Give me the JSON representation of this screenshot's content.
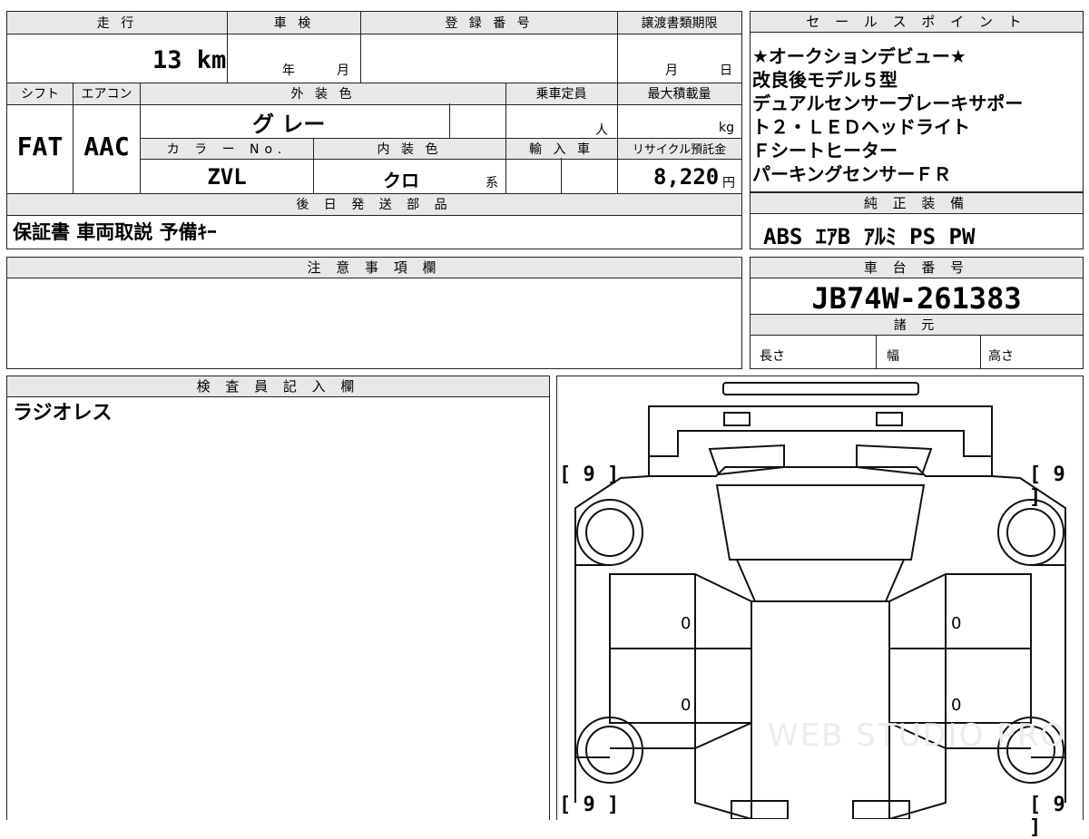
{
  "top_table": {
    "mileage_label": "走 行",
    "mileage_value": "13 km",
    "inspection_label": "車 検",
    "inspection_year_unit": "年",
    "inspection_month_unit": "月",
    "registration_label": "登 録 番 号",
    "transfer_deadline_label": "譲渡書類期限",
    "transfer_month_unit": "月",
    "transfer_day_unit": "日",
    "shift_label": "シフト",
    "shift_value": "FAT",
    "aircon_label": "エアコン",
    "aircon_value": "AAC",
    "exterior_color_label": "外 装 色",
    "exterior_color_value": "グ レー",
    "capacity_label": "乗車定員",
    "capacity_unit": "人",
    "max_load_label": "最大積載量",
    "max_load_unit": "kg",
    "color_no_label": "カ ラ ー No.",
    "color_no_value": "ZVL",
    "interior_color_label": "内 装 色",
    "interior_color_value": "クロ",
    "interior_color_suffix": "系",
    "import_label": "輸 入 車",
    "recycle_label": "リサイクル預託金",
    "recycle_value": "8,220",
    "recycle_unit": "円",
    "later_parts_label": "後 日 発 送 部 品",
    "later_parts_value": "保証書 車両取説 予備ｷｰ"
  },
  "sales_points": {
    "label": "セ ー ル ス ポ イ ン ト",
    "lines": [
      "★オークションデビュー★",
      "改良後モデル５型",
      "デュアルセンサーブレーキサポー",
      "ト２・ＬＥＤヘッドライト",
      "Ｆシートヒーター",
      "パーキングセンサーＦＲ"
    ]
  },
  "genuine_equipment": {
    "label": "純 正 装 備",
    "value": "ABS ｴｱB ｱﾙﾐ PS PW"
  },
  "notes": {
    "label": "注 意 事 項 欄"
  },
  "chassis": {
    "label": "車 台 番 号",
    "value": "JB74W-261383",
    "specs_label": "諸 元",
    "length_label": "長さ",
    "width_label": "幅",
    "height_label": "高さ"
  },
  "inspector": {
    "label": "検 査 員 記 入 欄",
    "comment": "ラジオレス"
  },
  "diagram": {
    "tire_front_left": "[ 9 ]",
    "tire_front_right": "[ 9 ]",
    "tire_rear_left": "[ 9 ]",
    "tire_rear_right": "[ 9 ]",
    "door_marks": [
      "0",
      "0",
      "0",
      "0"
    ],
    "watermark": "WEB STUDIO PRO"
  }
}
